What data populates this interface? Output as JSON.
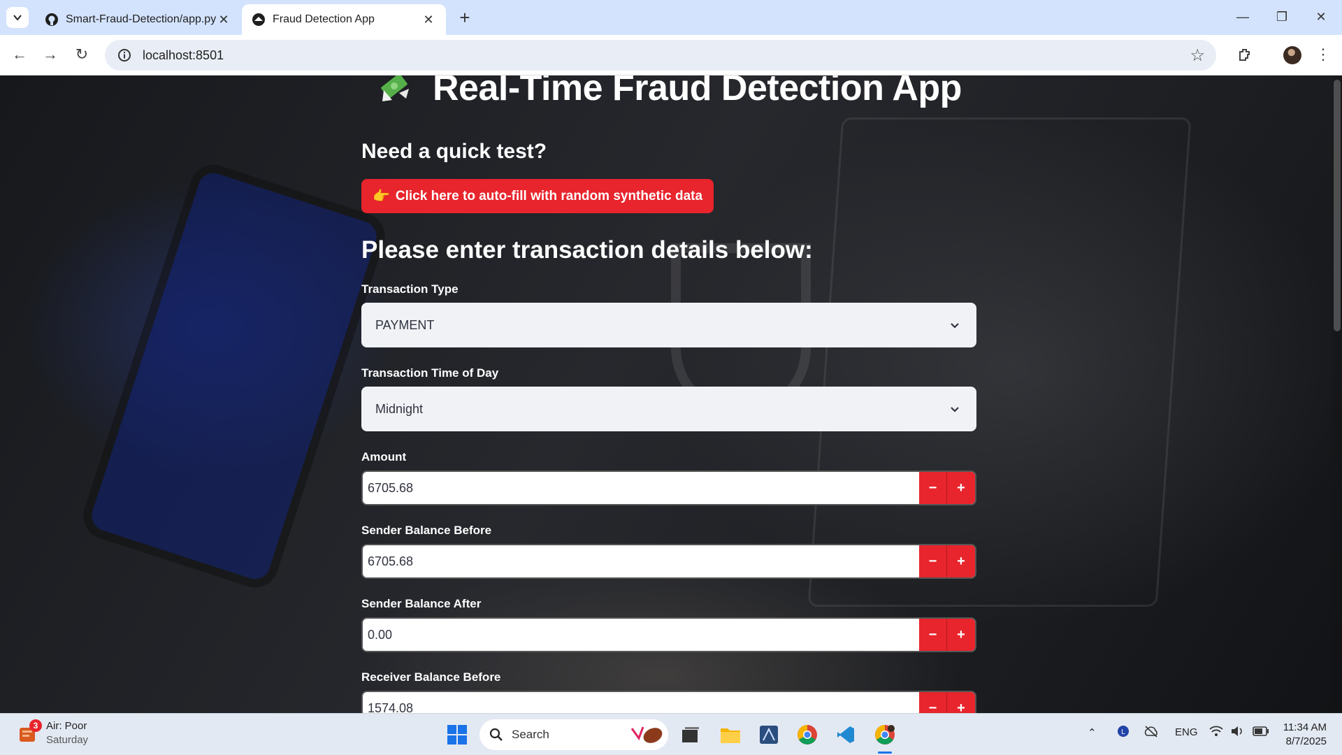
{
  "browser": {
    "tabs": [
      {
        "title": "Smart-Fraud-Detection/app.py",
        "icon": "github-icon",
        "active": false
      },
      {
        "title": "Fraud Detection App",
        "icon": "streamlit-icon",
        "active": true
      }
    ],
    "url": "localhost:8501"
  },
  "app": {
    "title": "Real-Time Fraud Detection App",
    "title_icon": "money-with-wings-icon",
    "quick_test_heading": "Need a quick test?",
    "autofill_icon": "👉",
    "autofill_label": "Click here to auto-fill with random synthetic data",
    "section_heading": "Please enter transaction details below:",
    "fields": {
      "transaction_type": {
        "label": "Transaction Type",
        "value": "PAYMENT"
      },
      "time_of_day": {
        "label": "Transaction Time of Day",
        "value": "Midnight"
      },
      "amount": {
        "label": "Amount",
        "value": "6705.68"
      },
      "sender_before": {
        "label": "Sender Balance Before",
        "value": "6705.68"
      },
      "sender_after": {
        "label": "Sender Balance After",
        "value": "0.00"
      },
      "receiver_before": {
        "label": "Receiver Balance Before",
        "value": "1574.08"
      }
    },
    "stepper": {
      "minus": "−",
      "plus": "+"
    },
    "accent_color": "#e8242c"
  },
  "taskbar": {
    "weather": {
      "title": "Air: Poor",
      "subtitle": "Saturday",
      "badge": "3"
    },
    "search_placeholder": "Search",
    "language": "ENG",
    "time": "11:34 AM",
    "date": "8/7/2025"
  }
}
